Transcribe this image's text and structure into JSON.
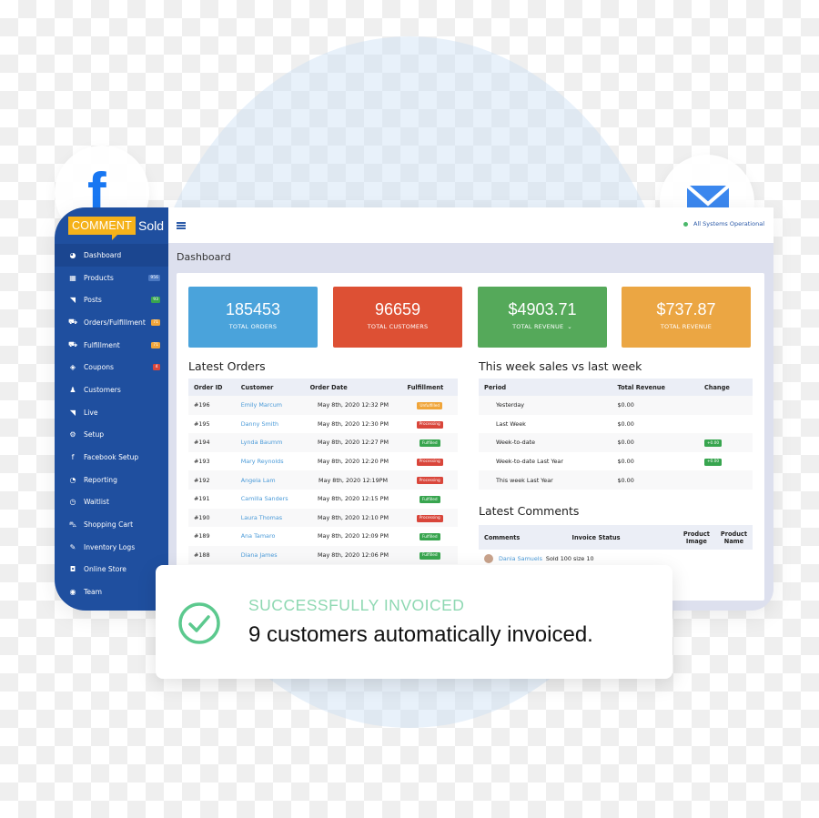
{
  "background": {
    "social_icons": [
      "facebook-icon",
      "mail-icon"
    ],
    "colors": {
      "facebook": "#1877f2",
      "mail": "#3b87ee"
    }
  },
  "brand": {
    "logo_highlight": "COMMENT",
    "logo_rest": "Sold",
    "logo_color": "#f5b21a"
  },
  "header": {
    "menu_icon": "hamburger-icon",
    "status_text": "All Systems Operational",
    "status_color": "#4bb86b"
  },
  "sidebar": {
    "items": [
      {
        "label": "Dashboard",
        "icon": "dashboard-icon",
        "glyph": "◕",
        "active": true
      },
      {
        "label": "Products",
        "icon": "grid-icon",
        "glyph": "▦",
        "badge": "956",
        "badge_color": "#4a78c2"
      },
      {
        "label": "Posts",
        "icon": "rss-icon",
        "glyph": "◥",
        "badge": "93",
        "badge_color": "#38a54f"
      },
      {
        "label": "Orders/Fulfillment",
        "icon": "truck-icon",
        "glyph": "⛟",
        "badge": "71",
        "badge_color": "#f0a53a"
      },
      {
        "label": "Fulfillment",
        "icon": "truck-icon",
        "glyph": "⛟",
        "badge": "71",
        "badge_color": "#f0a53a"
      },
      {
        "label": "Coupons",
        "icon": "ticket-icon",
        "glyph": "◈",
        "badge": "4",
        "badge_color": "#d9463b"
      },
      {
        "label": "Customers",
        "icon": "user-icon",
        "glyph": "♟"
      },
      {
        "label": "Live",
        "icon": "rss-icon",
        "glyph": "◥"
      },
      {
        "label": "Setup",
        "icon": "cogs-icon",
        "glyph": "⚙"
      },
      {
        "label": "Facebook Setup",
        "icon": "facebook-icon",
        "glyph": "f"
      },
      {
        "label": "Reporting",
        "icon": "pie-chart-icon",
        "glyph": "◔"
      },
      {
        "label": "Waitlist",
        "icon": "clock-icon",
        "glyph": "◷"
      },
      {
        "label": "Shopping Cart",
        "icon": "cart-icon",
        "glyph": "⛍"
      },
      {
        "label": "Inventory Logs",
        "icon": "wrench-icon",
        "glyph": "✎"
      },
      {
        "label": "Online Store",
        "icon": "bag-icon",
        "glyph": "◘"
      },
      {
        "label": "Team",
        "icon": "user-circle-icon",
        "glyph": "◉"
      }
    ]
  },
  "page": {
    "title": "Dashboard"
  },
  "stats": [
    {
      "value": "185453",
      "label": "TOTAL ORDERS",
      "color": "#4aa3db"
    },
    {
      "value": "96659",
      "label": "TOTAL CUSTOMERS",
      "color": "#dd5034"
    },
    {
      "value": "$4903.71",
      "label": "TOTAL REVENUE",
      "color": "#55a95a",
      "has_dropdown": true
    },
    {
      "value": "$737.87",
      "label": "TOTAL REVENUE",
      "color": "#eba643"
    }
  ],
  "latest_orders": {
    "title": "Latest Orders",
    "columns": [
      "Order ID",
      "Customer",
      "Order Date",
      "Fulfillment"
    ],
    "rows": [
      {
        "id": "#196",
        "customer": "Emily Marcum",
        "date": "May 8th, 2020 12:32 PM",
        "status": "Unfulfilled",
        "kind": "unf"
      },
      {
        "id": "#195",
        "customer": "Danny Smith",
        "date": "May 8th, 2020 12:30 PM",
        "status": "Processing",
        "kind": "pro"
      },
      {
        "id": "#194",
        "customer": "Lynda Baumm",
        "date": "May 8th, 2020 12:27 PM",
        "status": "Fulfilled",
        "kind": "ful"
      },
      {
        "id": "#193",
        "customer": "Mary Reynolds",
        "date": "May 8th, 2020 12:20 PM",
        "status": "Processing",
        "kind": "pro"
      },
      {
        "id": "#192",
        "customer": "Angela Lam",
        "date": "May 8th, 2020 12:19PM",
        "status": "Processing",
        "kind": "pro"
      },
      {
        "id": "#191",
        "customer": "Camilla Sanders",
        "date": "May 8th, 2020 12:15 PM",
        "status": "Fulfilled",
        "kind": "ful"
      },
      {
        "id": "#190",
        "customer": "Laura Thomas",
        "date": "May 8th, 2020 12:10 PM",
        "status": "Processing",
        "kind": "pro"
      },
      {
        "id": "#189",
        "customer": "Ana Tamaro",
        "date": "May 8th, 2020 12:09 PM",
        "status": "Fulfilled",
        "kind": "ful"
      },
      {
        "id": "#188",
        "customer": "Diana James",
        "date": "May 8th, 2020 12:06 PM",
        "status": "Fulfilled",
        "kind": "ful"
      }
    ]
  },
  "weekly_sales": {
    "title": "This week sales vs last week",
    "columns": [
      "Period",
      "Total Revenue",
      "Change"
    ],
    "rows": [
      {
        "period": "Yesterday",
        "revenue": "$0.00",
        "change": ""
      },
      {
        "period": "Last Week",
        "revenue": "$0.00",
        "change": ""
      },
      {
        "period": "Week-to-date",
        "revenue": "$0.00",
        "change": "+0.00"
      },
      {
        "period": "Week-to-date Last Year",
        "revenue": "$0.00",
        "change": "+0.00"
      },
      {
        "period": "This week Last Year",
        "revenue": "$0.00",
        "change": ""
      }
    ]
  },
  "latest_comments": {
    "title": "Latest Comments",
    "columns": [
      "Comments",
      "Invoice Status",
      "Product Image",
      "Product Name"
    ],
    "rows": [
      {
        "author": "Dania Samuels",
        "text": "Sold 100 size 10"
      }
    ]
  },
  "toast": {
    "heading": "SUCCESSFULLY INVOICED",
    "message": "9 customers automatically invoiced.",
    "icon": "check-circle-icon",
    "accent": "#5cc98e"
  }
}
